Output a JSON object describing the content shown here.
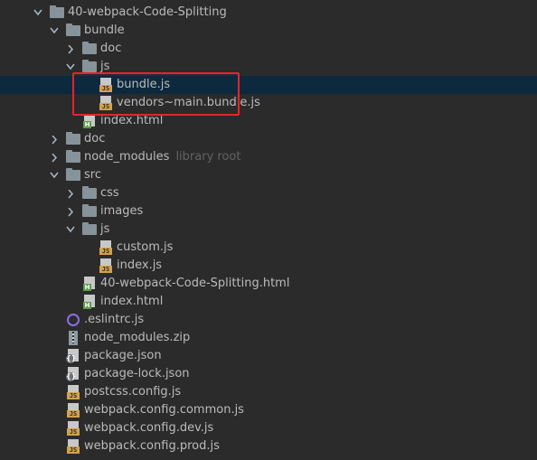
{
  "tree": [
    {
      "name": "40-webpack-Code-Splitting",
      "kind": "folder",
      "state": "open",
      "depth": 0
    },
    {
      "name": "bundle",
      "kind": "folder",
      "state": "open",
      "depth": 1
    },
    {
      "name": "doc",
      "kind": "folder",
      "state": "closed",
      "depth": 2
    },
    {
      "name": "js",
      "kind": "folder",
      "state": "open",
      "depth": 2
    },
    {
      "name": "bundle.js",
      "kind": "js",
      "depth": 3,
      "selected": true
    },
    {
      "name": "vendors~main.bundle.js",
      "kind": "js",
      "depth": 3
    },
    {
      "name": "index.html",
      "kind": "html",
      "depth": 2
    },
    {
      "name": "doc",
      "kind": "folder",
      "state": "closed",
      "depth": 1
    },
    {
      "name": "node_modules",
      "kind": "folder",
      "state": "closed",
      "depth": 1,
      "hint": "library root"
    },
    {
      "name": "src",
      "kind": "folder",
      "state": "open",
      "depth": 1
    },
    {
      "name": "css",
      "kind": "folder",
      "state": "closed",
      "depth": 2
    },
    {
      "name": "images",
      "kind": "folder",
      "state": "closed",
      "depth": 2
    },
    {
      "name": "js",
      "kind": "folder",
      "state": "open",
      "depth": 2
    },
    {
      "name": "custom.js",
      "kind": "js",
      "depth": 3
    },
    {
      "name": "index.js",
      "kind": "js",
      "depth": 3
    },
    {
      "name": "40-webpack-Code-Splitting.html",
      "kind": "html",
      "depth": 2
    },
    {
      "name": "index.html",
      "kind": "html",
      "depth": 2
    },
    {
      "name": ".eslintrc.js",
      "kind": "eslint",
      "depth": 1
    },
    {
      "name": "node_modules.zip",
      "kind": "zip",
      "depth": 1
    },
    {
      "name": "package.json",
      "kind": "json",
      "depth": 1
    },
    {
      "name": "package-lock.json",
      "kind": "json",
      "depth": 1
    },
    {
      "name": "postcss.config.js",
      "kind": "js",
      "depth": 1
    },
    {
      "name": "webpack.config.common.js",
      "kind": "js",
      "depth": 1
    },
    {
      "name": "webpack.config.dev.js",
      "kind": "js",
      "depth": 1
    },
    {
      "name": "webpack.config.prod.js",
      "kind": "js",
      "depth": 1
    }
  ],
  "icons": {
    "folder": "folder-icon",
    "js": "js-file-icon",
    "html": "html-file-icon",
    "json": "json-file-icon",
    "zip": "zip-file-icon",
    "eslint": "eslint-config-icon",
    "open": "chevron-down-icon",
    "closed": "chevron-right-icon"
  },
  "colors": {
    "background": "#2b2b2b",
    "selection": "#0d293e",
    "text": "#bbbbbb",
    "hint": "#626262",
    "highlight_box": "#e8232b",
    "js_badge": "#d3a24d",
    "html_badge": "#5e9b4c"
  }
}
